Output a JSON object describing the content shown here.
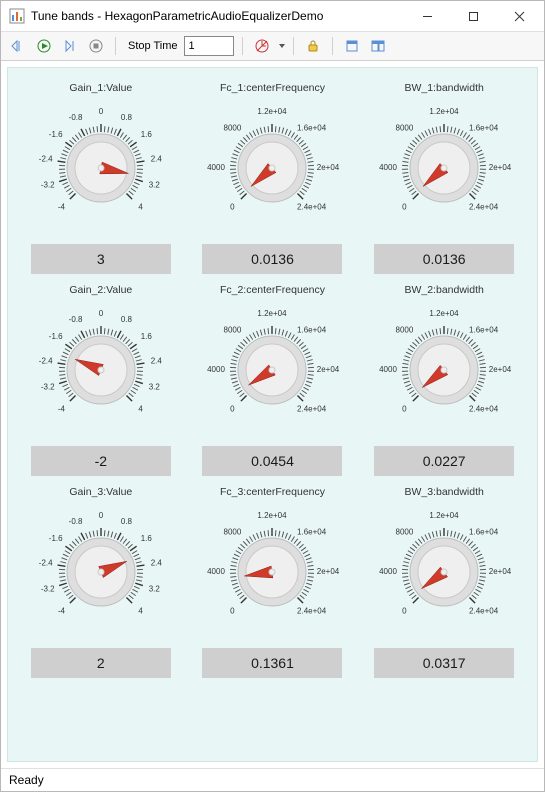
{
  "window": {
    "title": "Tune bands - HexagonParametricAudioEqualizerDemo"
  },
  "toolbar": {
    "stop_time_label": "Stop Time",
    "stop_time_value": "1"
  },
  "status": {
    "text": "Ready"
  },
  "knobs": [
    {
      "label": "Gain_1:Value",
      "readout": "3",
      "min": -4,
      "max": 4,
      "value": 3,
      "scale": [
        {
          "frac": 0.0,
          "txt": "-4"
        },
        {
          "frac": 0.1,
          "txt": "-3.2"
        },
        {
          "frac": 0.2,
          "txt": "-2.4"
        },
        {
          "frac": 0.3,
          "txt": "-1.6"
        },
        {
          "frac": 0.4,
          "txt": "-0.8"
        },
        {
          "frac": 0.5,
          "txt": "0"
        },
        {
          "frac": 0.6,
          "txt": "0.8"
        },
        {
          "frac": 0.7,
          "txt": "1.6"
        },
        {
          "frac": 0.8,
          "txt": "2.4"
        },
        {
          "frac": 0.9,
          "txt": "3.2"
        },
        {
          "frac": 1.0,
          "txt": "4"
        }
      ]
    },
    {
      "label": "Fc_1:centerFrequency",
      "readout": "0.0136",
      "min": 0,
      "max": 24000,
      "value": 327,
      "scale": [
        {
          "frac": 0.0,
          "txt": "0"
        },
        {
          "frac": 0.1667,
          "txt": "4000"
        },
        {
          "frac": 0.3333,
          "txt": "8000"
        },
        {
          "frac": 0.5,
          "txt": "1.2e+04"
        },
        {
          "frac": 0.6667,
          "txt": "1.6e+04"
        },
        {
          "frac": 0.8333,
          "txt": "2e+04"
        },
        {
          "frac": 1.0,
          "txt": "2.4e+04"
        }
      ]
    },
    {
      "label": "BW_1:bandwidth",
      "readout": "0.0136",
      "min": 0,
      "max": 24000,
      "value": 327,
      "scale": [
        {
          "frac": 0.0,
          "txt": "0"
        },
        {
          "frac": 0.1667,
          "txt": "4000"
        },
        {
          "frac": 0.3333,
          "txt": "8000"
        },
        {
          "frac": 0.5,
          "txt": "1.2e+04"
        },
        {
          "frac": 0.6667,
          "txt": "1.6e+04"
        },
        {
          "frac": 0.8333,
          "txt": "2e+04"
        },
        {
          "frac": 1.0,
          "txt": "2.4e+04"
        }
      ]
    },
    {
      "label": "Gain_2:Value",
      "readout": "-2",
      "min": -4,
      "max": 4,
      "value": -2,
      "scale": [
        {
          "frac": 0.0,
          "txt": "-4"
        },
        {
          "frac": 0.1,
          "txt": "-3.2"
        },
        {
          "frac": 0.2,
          "txt": "-2.4"
        },
        {
          "frac": 0.3,
          "txt": "-1.6"
        },
        {
          "frac": 0.4,
          "txt": "-0.8"
        },
        {
          "frac": 0.5,
          "txt": "0"
        },
        {
          "frac": 0.6,
          "txt": "0.8"
        },
        {
          "frac": 0.7,
          "txt": "1.6"
        },
        {
          "frac": 0.8,
          "txt": "2.4"
        },
        {
          "frac": 0.9,
          "txt": "3.2"
        },
        {
          "frac": 1.0,
          "txt": "4"
        }
      ]
    },
    {
      "label": "Fc_2:centerFrequency",
      "readout": "0.0454",
      "min": 0,
      "max": 24000,
      "value": 1089,
      "scale": [
        {
          "frac": 0.0,
          "txt": "0"
        },
        {
          "frac": 0.1667,
          "txt": "4000"
        },
        {
          "frac": 0.3333,
          "txt": "8000"
        },
        {
          "frac": 0.5,
          "txt": "1.2e+04"
        },
        {
          "frac": 0.6667,
          "txt": "1.6e+04"
        },
        {
          "frac": 0.8333,
          "txt": "2e+04"
        },
        {
          "frac": 1.0,
          "txt": "2.4e+04"
        }
      ]
    },
    {
      "label": "BW_2:bandwidth",
      "readout": "0.0227",
      "min": 0,
      "max": 24000,
      "value": 545,
      "scale": [
        {
          "frac": 0.0,
          "txt": "0"
        },
        {
          "frac": 0.1667,
          "txt": "4000"
        },
        {
          "frac": 0.3333,
          "txt": "8000"
        },
        {
          "frac": 0.5,
          "txt": "1.2e+04"
        },
        {
          "frac": 0.6667,
          "txt": "1.6e+04"
        },
        {
          "frac": 0.8333,
          "txt": "2e+04"
        },
        {
          "frac": 1.0,
          "txt": "2.4e+04"
        }
      ]
    },
    {
      "label": "Gain_3:Value",
      "readout": "2",
      "min": -4,
      "max": 4,
      "value": 2,
      "scale": [
        {
          "frac": 0.0,
          "txt": "-4"
        },
        {
          "frac": 0.1,
          "txt": "-3.2"
        },
        {
          "frac": 0.2,
          "txt": "-2.4"
        },
        {
          "frac": 0.3,
          "txt": "-1.6"
        },
        {
          "frac": 0.4,
          "txt": "-0.8"
        },
        {
          "frac": 0.5,
          "txt": "0"
        },
        {
          "frac": 0.6,
          "txt": "0.8"
        },
        {
          "frac": 0.7,
          "txt": "1.6"
        },
        {
          "frac": 0.8,
          "txt": "2.4"
        },
        {
          "frac": 0.9,
          "txt": "3.2"
        },
        {
          "frac": 1.0,
          "txt": "4"
        }
      ]
    },
    {
      "label": "Fc_3:centerFrequency",
      "readout": "0.1361",
      "min": 0,
      "max": 24000,
      "value": 3266,
      "scale": [
        {
          "frac": 0.0,
          "txt": "0"
        },
        {
          "frac": 0.1667,
          "txt": "4000"
        },
        {
          "frac": 0.3333,
          "txt": "8000"
        },
        {
          "frac": 0.5,
          "txt": "1.2e+04"
        },
        {
          "frac": 0.6667,
          "txt": "1.6e+04"
        },
        {
          "frac": 0.8333,
          "txt": "2e+04"
        },
        {
          "frac": 1.0,
          "txt": "2.4e+04"
        }
      ]
    },
    {
      "label": "BW_3:bandwidth",
      "readout": "0.0317",
      "min": 0,
      "max": 24000,
      "value": 761,
      "scale": [
        {
          "frac": 0.0,
          "txt": "0"
        },
        {
          "frac": 0.1667,
          "txt": "4000"
        },
        {
          "frac": 0.3333,
          "txt": "8000"
        },
        {
          "frac": 0.5,
          "txt": "1.2e+04"
        },
        {
          "frac": 0.6667,
          "txt": "1.6e+04"
        },
        {
          "frac": 0.8333,
          "txt": "2e+04"
        },
        {
          "frac": 1.0,
          "txt": "2.4e+04"
        }
      ]
    }
  ]
}
